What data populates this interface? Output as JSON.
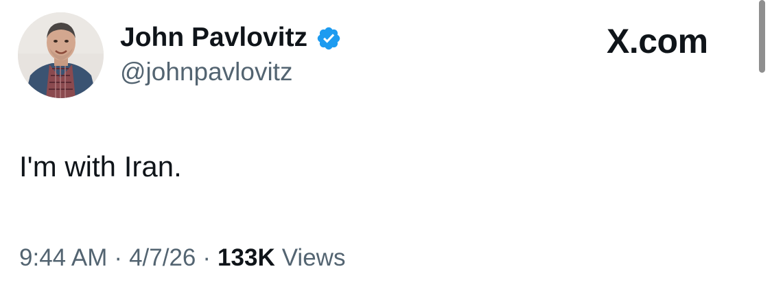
{
  "author": {
    "display_name": "John Pavlovitz",
    "handle": "@johnpavlovitz",
    "verified": true
  },
  "brand": {
    "label": "X.com"
  },
  "tweet": {
    "text": "I'm with Iran."
  },
  "meta": {
    "time": "9:44 AM",
    "separator": "·",
    "date": "4/7/26",
    "views_count": "133K",
    "views_label": "Views"
  },
  "icons": {
    "verified": "verified-badge-icon",
    "avatar": "profile-photo"
  },
  "colors": {
    "text_primary": "#0f1419",
    "text_secondary": "#536471",
    "verified_blue": "#1d9bf0",
    "background": "#ffffff"
  }
}
